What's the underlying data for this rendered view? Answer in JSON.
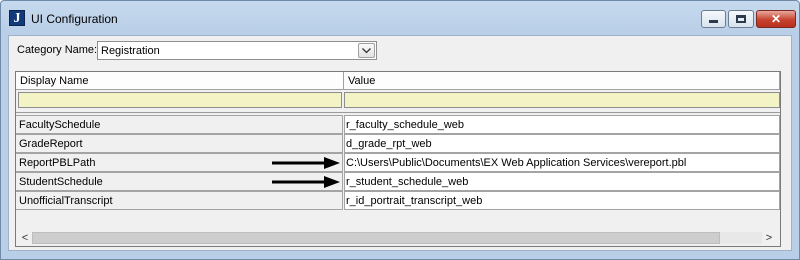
{
  "window": {
    "title": "UI Configuration",
    "app_icon_letter": "J"
  },
  "category": {
    "label": "Category Name:",
    "selected": "Registration"
  },
  "grid": {
    "columns": [
      "Display Name",
      "Value"
    ],
    "rows": [
      {
        "name": "FacultySchedule",
        "value": "r_faculty_schedule_web",
        "arrow": false
      },
      {
        "name": "GradeReport",
        "value": "d_grade_rpt_web",
        "arrow": false
      },
      {
        "name": "ReportPBLPath",
        "value": "C:\\Users\\Public\\Documents\\EX Web Application Services\\vereport.pbl",
        "arrow": true
      },
      {
        "name": "StudentSchedule",
        "value": "r_student_schedule_web",
        "arrow": true
      },
      {
        "name": "UnofficialTranscript",
        "value": "r_id_portrait_transcript_web",
        "arrow": false
      }
    ]
  },
  "colors": {
    "filter_row": "#f3f3c6",
    "arrow": "#000000"
  }
}
